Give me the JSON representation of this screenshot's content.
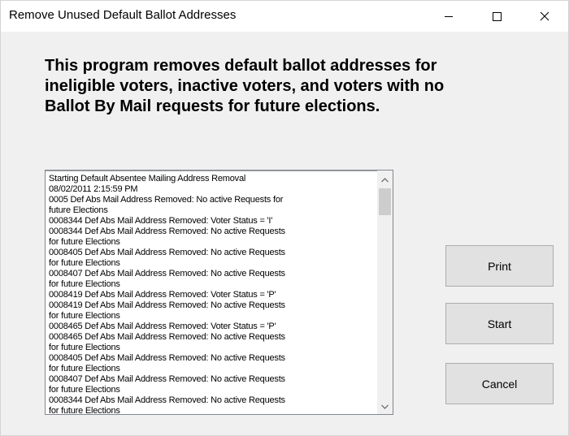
{
  "window": {
    "title": "Remove Unused Default Ballot Addresses"
  },
  "headline": "This program removes default ballot addresses for ineligible voters, inactive voters, and voters with no Ballot By Mail requests for future elections.",
  "log": {
    "lines": [
      "Starting Default Absentee Mailing Address Removal",
      "08/02/2011 2:15:59 PM",
      "0005 Def Abs Mail Address Removed: No active Requests for",
      "future Elections",
      "0008344 Def Abs Mail Address Removed: Voter Status = 'I'",
      "0008344 Def Abs Mail Address Removed: No active Requests",
      "for future Elections",
      "0008405 Def Abs Mail Address Removed: No active Requests",
      "for future Elections",
      "0008407 Def Abs Mail Address Removed: No active Requests",
      "for future Elections",
      "0008419 Def Abs Mail Address Removed: Voter Status = 'P'",
      "0008419 Def Abs Mail Address Removed: No active Requests",
      "for future Elections",
      "0008465 Def Abs Mail Address Removed: Voter Status = 'P'",
      "0008465 Def Abs Mail Address Removed: No active Requests",
      "for future Elections",
      "0008405 Def Abs Mail Address Removed: No active Requests",
      "for future Elections",
      "0008407 Def Abs Mail Address Removed: No active Requests",
      "for future Elections",
      "0008344 Def Abs Mail Address Removed: No active Requests",
      "for future Elections"
    ]
  },
  "buttons": {
    "print": "Print",
    "start": "Start",
    "cancel": "Cancel"
  },
  "icons": {
    "minimize": "minimize-icon",
    "maximize": "maximize-icon",
    "close": "close-icon",
    "scroll_up": "chevron-up-icon",
    "scroll_down": "chevron-down-icon"
  }
}
